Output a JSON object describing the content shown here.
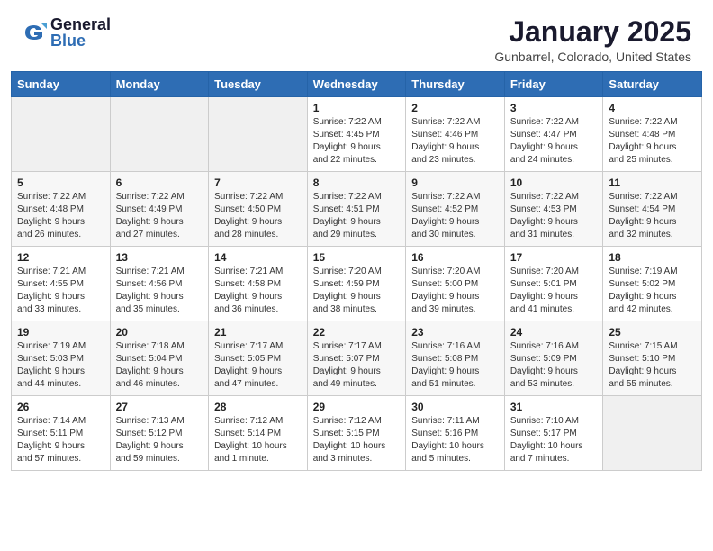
{
  "header": {
    "logo_general": "General",
    "logo_blue": "Blue",
    "month_title": "January 2025",
    "location": "Gunbarrel, Colorado, United States"
  },
  "days_of_week": [
    "Sunday",
    "Monday",
    "Tuesday",
    "Wednesday",
    "Thursday",
    "Friday",
    "Saturday"
  ],
  "weeks": [
    [
      {
        "day": "",
        "info": ""
      },
      {
        "day": "",
        "info": ""
      },
      {
        "day": "",
        "info": ""
      },
      {
        "day": "1",
        "info": "Sunrise: 7:22 AM\nSunset: 4:45 PM\nDaylight: 9 hours\nand 22 minutes."
      },
      {
        "day": "2",
        "info": "Sunrise: 7:22 AM\nSunset: 4:46 PM\nDaylight: 9 hours\nand 23 minutes."
      },
      {
        "day": "3",
        "info": "Sunrise: 7:22 AM\nSunset: 4:47 PM\nDaylight: 9 hours\nand 24 minutes."
      },
      {
        "day": "4",
        "info": "Sunrise: 7:22 AM\nSunset: 4:48 PM\nDaylight: 9 hours\nand 25 minutes."
      }
    ],
    [
      {
        "day": "5",
        "info": "Sunrise: 7:22 AM\nSunset: 4:48 PM\nDaylight: 9 hours\nand 26 minutes."
      },
      {
        "day": "6",
        "info": "Sunrise: 7:22 AM\nSunset: 4:49 PM\nDaylight: 9 hours\nand 27 minutes."
      },
      {
        "day": "7",
        "info": "Sunrise: 7:22 AM\nSunset: 4:50 PM\nDaylight: 9 hours\nand 28 minutes."
      },
      {
        "day": "8",
        "info": "Sunrise: 7:22 AM\nSunset: 4:51 PM\nDaylight: 9 hours\nand 29 minutes."
      },
      {
        "day": "9",
        "info": "Sunrise: 7:22 AM\nSunset: 4:52 PM\nDaylight: 9 hours\nand 30 minutes."
      },
      {
        "day": "10",
        "info": "Sunrise: 7:22 AM\nSunset: 4:53 PM\nDaylight: 9 hours\nand 31 minutes."
      },
      {
        "day": "11",
        "info": "Sunrise: 7:22 AM\nSunset: 4:54 PM\nDaylight: 9 hours\nand 32 minutes."
      }
    ],
    [
      {
        "day": "12",
        "info": "Sunrise: 7:21 AM\nSunset: 4:55 PM\nDaylight: 9 hours\nand 33 minutes."
      },
      {
        "day": "13",
        "info": "Sunrise: 7:21 AM\nSunset: 4:56 PM\nDaylight: 9 hours\nand 35 minutes."
      },
      {
        "day": "14",
        "info": "Sunrise: 7:21 AM\nSunset: 4:58 PM\nDaylight: 9 hours\nand 36 minutes."
      },
      {
        "day": "15",
        "info": "Sunrise: 7:20 AM\nSunset: 4:59 PM\nDaylight: 9 hours\nand 38 minutes."
      },
      {
        "day": "16",
        "info": "Sunrise: 7:20 AM\nSunset: 5:00 PM\nDaylight: 9 hours\nand 39 minutes."
      },
      {
        "day": "17",
        "info": "Sunrise: 7:20 AM\nSunset: 5:01 PM\nDaylight: 9 hours\nand 41 minutes."
      },
      {
        "day": "18",
        "info": "Sunrise: 7:19 AM\nSunset: 5:02 PM\nDaylight: 9 hours\nand 42 minutes."
      }
    ],
    [
      {
        "day": "19",
        "info": "Sunrise: 7:19 AM\nSunset: 5:03 PM\nDaylight: 9 hours\nand 44 minutes."
      },
      {
        "day": "20",
        "info": "Sunrise: 7:18 AM\nSunset: 5:04 PM\nDaylight: 9 hours\nand 46 minutes."
      },
      {
        "day": "21",
        "info": "Sunrise: 7:17 AM\nSunset: 5:05 PM\nDaylight: 9 hours\nand 47 minutes."
      },
      {
        "day": "22",
        "info": "Sunrise: 7:17 AM\nSunset: 5:07 PM\nDaylight: 9 hours\nand 49 minutes."
      },
      {
        "day": "23",
        "info": "Sunrise: 7:16 AM\nSunset: 5:08 PM\nDaylight: 9 hours\nand 51 minutes."
      },
      {
        "day": "24",
        "info": "Sunrise: 7:16 AM\nSunset: 5:09 PM\nDaylight: 9 hours\nand 53 minutes."
      },
      {
        "day": "25",
        "info": "Sunrise: 7:15 AM\nSunset: 5:10 PM\nDaylight: 9 hours\nand 55 minutes."
      }
    ],
    [
      {
        "day": "26",
        "info": "Sunrise: 7:14 AM\nSunset: 5:11 PM\nDaylight: 9 hours\nand 57 minutes."
      },
      {
        "day": "27",
        "info": "Sunrise: 7:13 AM\nSunset: 5:12 PM\nDaylight: 9 hours\nand 59 minutes."
      },
      {
        "day": "28",
        "info": "Sunrise: 7:12 AM\nSunset: 5:14 PM\nDaylight: 10 hours\nand 1 minute."
      },
      {
        "day": "29",
        "info": "Sunrise: 7:12 AM\nSunset: 5:15 PM\nDaylight: 10 hours\nand 3 minutes."
      },
      {
        "day": "30",
        "info": "Sunrise: 7:11 AM\nSunset: 5:16 PM\nDaylight: 10 hours\nand 5 minutes."
      },
      {
        "day": "31",
        "info": "Sunrise: 7:10 AM\nSunset: 5:17 PM\nDaylight: 10 hours\nand 7 minutes."
      },
      {
        "day": "",
        "info": ""
      }
    ]
  ]
}
